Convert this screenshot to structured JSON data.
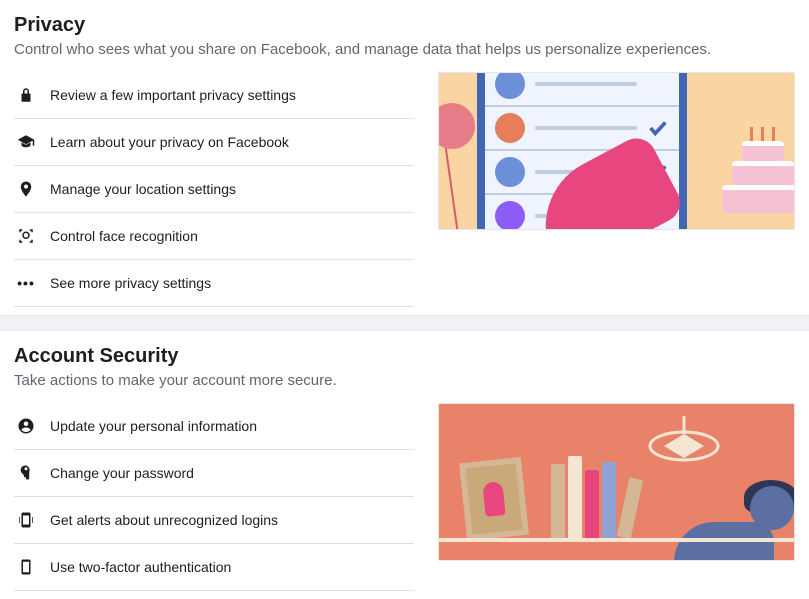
{
  "privacy": {
    "title": "Privacy",
    "subtitle": "Control who sees what you share on Facebook, and manage data that helps us personalize experiences.",
    "items": [
      {
        "label": "Review a few important privacy settings"
      },
      {
        "label": "Learn about your privacy on Facebook"
      },
      {
        "label": "Manage your location settings"
      },
      {
        "label": "Control face recognition"
      },
      {
        "label": "See more privacy settings"
      }
    ]
  },
  "security": {
    "title": "Account Security",
    "subtitle": "Take actions to make your account more secure.",
    "items": [
      {
        "label": "Update your personal information"
      },
      {
        "label": "Change your password"
      },
      {
        "label": "Get alerts about unrecognized logins"
      },
      {
        "label": "Use two-factor authentication"
      }
    ]
  }
}
